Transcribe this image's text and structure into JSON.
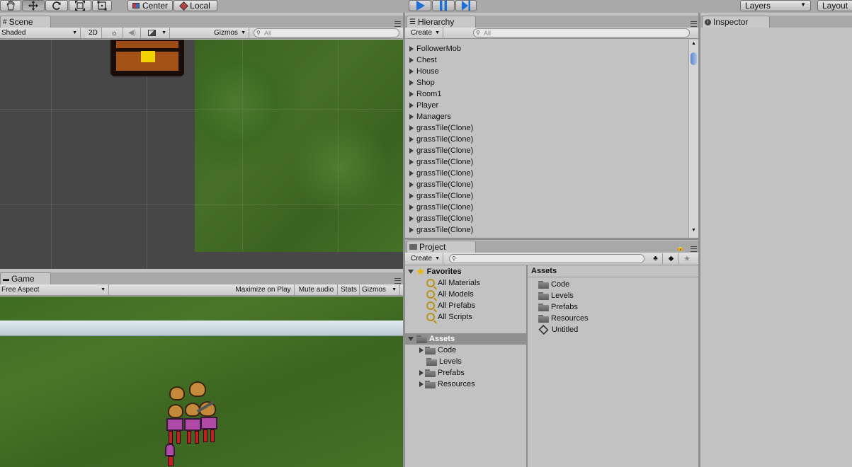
{
  "toolbar": {
    "pivot_label": "Center",
    "space_label": "Local",
    "layers_label": "Layers",
    "layout_label": "Layout",
    "icons": [
      "hand-icon",
      "move-icon",
      "rotate-icon",
      "scale-icon",
      "rect-icon",
      "play-icon",
      "pause-icon",
      "step-icon"
    ]
  },
  "scene": {
    "tab_label": "Scene",
    "shading": "Shaded",
    "mode_2d": "2D",
    "gizmos": "Gizmos",
    "search_placeholder": "All"
  },
  "game": {
    "tab_label": "Game",
    "aspect": "Free Aspect",
    "maximize": "Maximize on Play",
    "mute": "Mute audio",
    "stats": "Stats",
    "gizmos": "Gizmos"
  },
  "hierarchy": {
    "tab_label": "Hierarchy",
    "create": "Create",
    "search_placeholder": "All",
    "items": [
      "FollowerMob",
      "Chest",
      "House",
      "Shop",
      "Room1",
      "Player",
      "Managers",
      "grassTile(Clone)",
      "grassTile(Clone)",
      "grassTile(Clone)",
      "grassTile(Clone)",
      "grassTile(Clone)",
      "grassTile(Clone)",
      "grassTile(Clone)",
      "grassTile(Clone)",
      "grassTile(Clone)",
      "grassTile(Clone)",
      "grassTile(Clone)"
    ]
  },
  "project": {
    "tab_label": "Project",
    "create": "Create",
    "favorites_label": "Favorites",
    "favorites": [
      "All Materials",
      "All Models",
      "All Prefabs",
      "All Scripts"
    ],
    "assets_label": "Assets",
    "asset_folders": [
      "Code",
      "Levels",
      "Prefabs",
      "Resources"
    ],
    "right_header": "Assets",
    "right_items": [
      "Code",
      "Levels",
      "Prefabs",
      "Resources",
      "Untitled"
    ]
  },
  "inspector": {
    "tab_label": "Inspector"
  },
  "colors": {
    "grass": "#3d6a22",
    "scene_bg": "#474747",
    "play_blue": "#1d6fd8"
  }
}
